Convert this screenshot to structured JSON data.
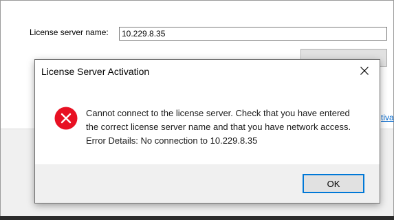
{
  "background_window": {
    "server_label": "License server name:",
    "server_value": "10.229.8.35",
    "link_fragment": "tiva"
  },
  "dialog": {
    "title": "License Server Activation",
    "icon": "error-icon",
    "message_lines": [
      "Cannot connect to the license server. Check that you have entered",
      "the correct license server name and that you have network access.",
      "Error Details: No connection to 10.229.8.35"
    ],
    "ok_label": "OK"
  },
  "colors": {
    "error_red": "#e81123",
    "focus_blue": "#0078d7",
    "link_blue": "#0066cc"
  }
}
